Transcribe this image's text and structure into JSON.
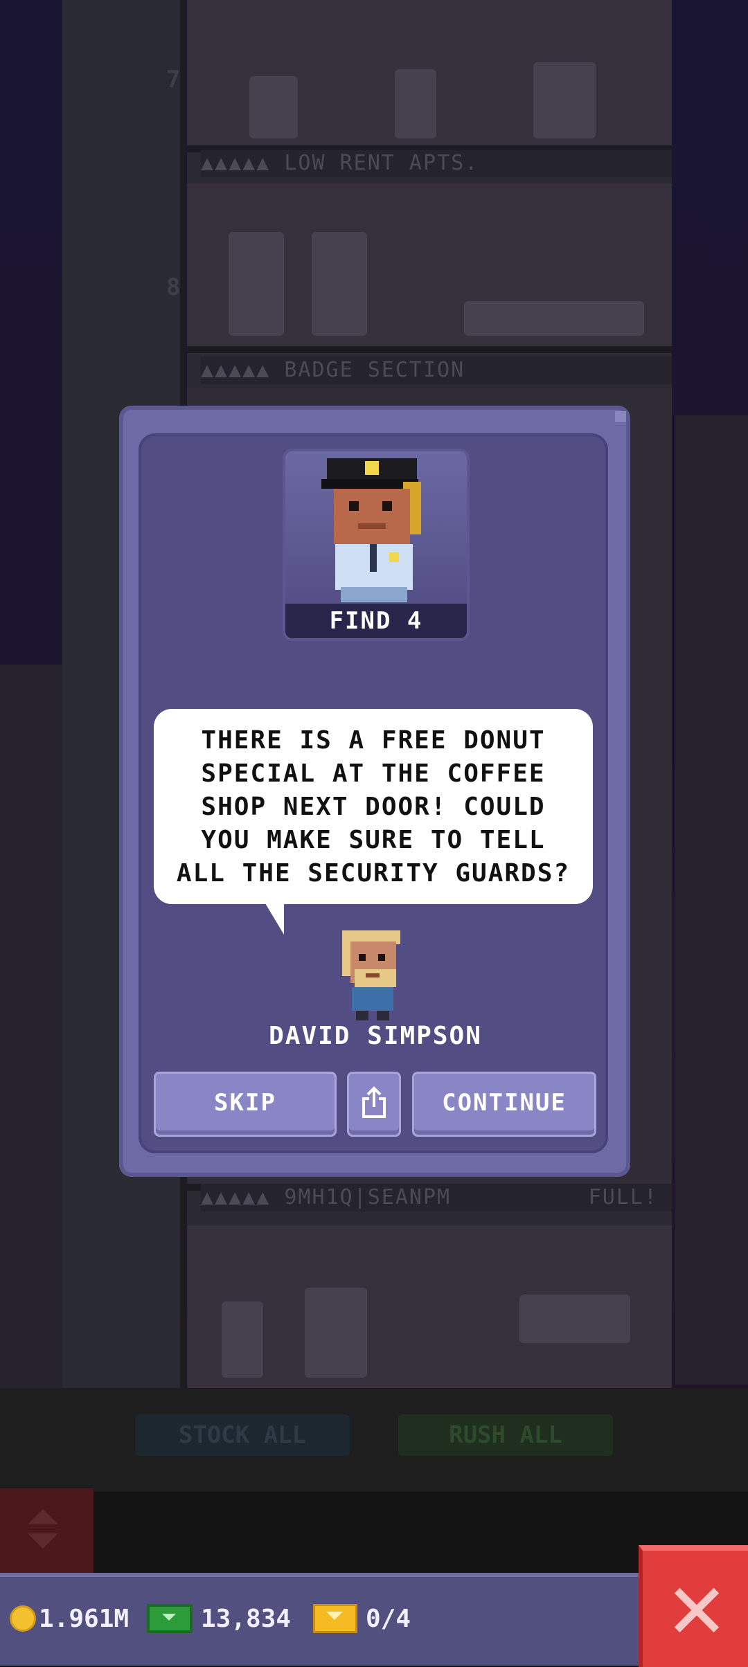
{
  "background": {
    "shaft_numbers": [
      "7",
      "8"
    ],
    "floors": [
      {
        "label": "▲▲▲▲▲  LOW RENT APTS."
      },
      {
        "label": "▲▲▲▲▲  BADGE SECTION"
      },
      {
        "label": "▲▲▲▲▲  9MH1Q|SEANPM",
        "status": "FULL!"
      }
    ],
    "stock_all_label": "STOCK ALL",
    "rush_all_label": "RUSH ALL"
  },
  "dialog": {
    "portrait_label": "FIND 4",
    "message": "THERE IS A FREE DONUT SPECIAL AT THE COFFEE SHOP NEXT DOOR! COULD YOU MAKE SURE TO TELL ALL THE SECURITY GUARDS?",
    "speaker_name": "DAVID SIMPSON",
    "skip_label": "SKIP",
    "continue_label": "CONTINUE",
    "share_icon": "share-icon"
  },
  "bottom_bar": {
    "coins": "1.961M",
    "bux": "13,834",
    "tickets": "0/4",
    "close_icon": "close-icon"
  },
  "colors": {
    "dialog_frame": "#6e6aa6",
    "dialog_inner": "#524e84",
    "button": "#8a86c6",
    "close": "#e23d3d"
  }
}
